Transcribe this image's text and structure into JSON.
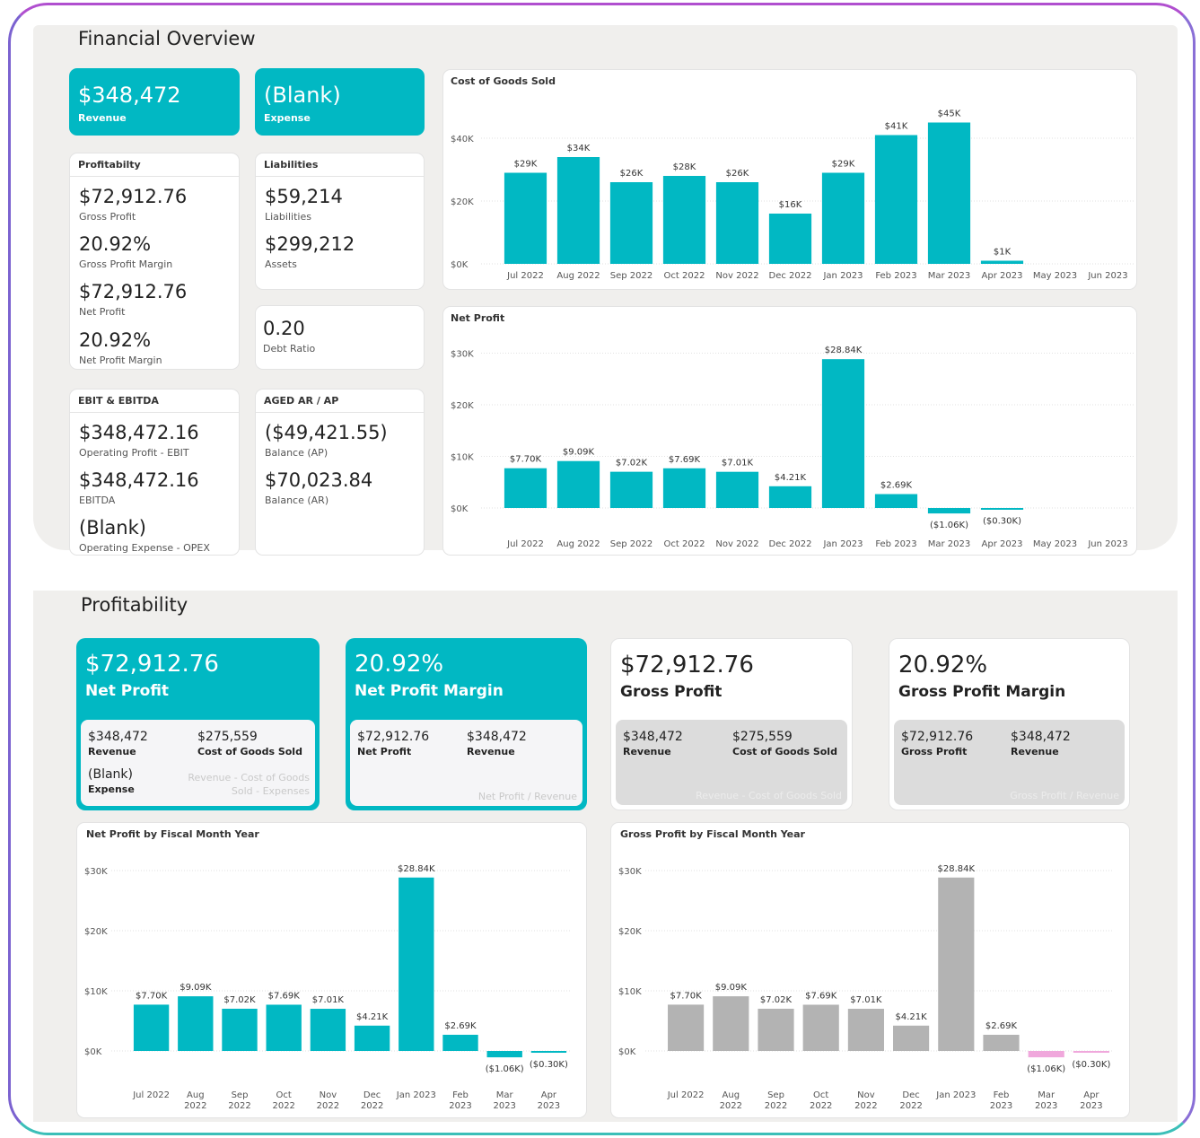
{
  "financial_overview": {
    "title": "Financial Overview",
    "revenue_value": "$348,472",
    "revenue_label": "Revenue",
    "expense_value": "(Blank)",
    "expense_label": "Expense",
    "profitability": {
      "header": "Profitabilty",
      "gross_profit": "$72,912.76",
      "gross_profit_label": "Gross Profit",
      "gross_margin": "20.92%",
      "gross_margin_label": "Gross Profit Margin",
      "net_profit": "$72,912.76",
      "net_profit_label": "Net Profit",
      "net_margin": "20.92%",
      "net_margin_label": "Net Profit Margin"
    },
    "liabilities": {
      "header": "Liabilities",
      "liabilities": "$59,214",
      "liabilities_label": "Liabilities",
      "assets": "$299,212",
      "assets_label": "Assets"
    },
    "debt_ratio": {
      "value": "0.20",
      "label": "Debt Ratio"
    },
    "ebit": {
      "header": "EBIT & EBITDA",
      "ebit": "$348,472.16",
      "ebit_label": "Operating Profit - EBIT",
      "ebitda": "$348,472.16",
      "ebitda_label": "EBITDA",
      "opex": "(Blank)",
      "opex_label": "Operating Expense - OPEX"
    },
    "aged": {
      "header": "AGED AR / AP",
      "ap": "($49,421.55)",
      "ap_label": "Balance (AP)",
      "ar": "$70,023.84",
      "ar_label": "Balance (AR)"
    }
  },
  "profitability_section": {
    "title": "Profitability",
    "net_profit_card": {
      "value": "$72,912.76",
      "label": "Net Profit",
      "revenue": "$348,472",
      "revenue_label": "Revenue",
      "cogs": "$275,559",
      "cogs_label": "Cost of Goods Sold",
      "expense": "(Blank)",
      "expense_label": "Expense",
      "formula": "Revenue - Cost of Goods Sold - Expenses"
    },
    "net_margin_card": {
      "value": "20.92%",
      "label": "Net Profit Margin",
      "net_profit": "$72,912.76",
      "net_profit_label": "Net Profit",
      "revenue": "$348,472",
      "revenue_label": "Revenue",
      "formula": "Net Profit / Revenue"
    },
    "gross_profit_card": {
      "value": "$72,912.76",
      "label": "Gross Profit",
      "revenue": "$348,472",
      "revenue_label": "Revenue",
      "cogs": "$275,559",
      "cogs_label": "Cost of Goods Sold",
      "formula": "Revenue - Cost of Goods Sold"
    },
    "gross_margin_card": {
      "value": "20.92%",
      "label": "Gross Profit Margin",
      "gross_profit": "$72,912.76",
      "gross_profit_label": "Gross Profit",
      "revenue": "$348,472",
      "revenue_label": "Revenue",
      "formula": "Gross Profit / Revenue"
    }
  },
  "colors": {
    "teal": "#01b8c3",
    "grey_bar": "#b3b3b3",
    "pink_bar": "#f0a8dc"
  },
  "chart_data": [
    {
      "type": "bar",
      "title": "Cost of Goods Sold",
      "categories": [
        "Jul 2022",
        "Aug 2022",
        "Sep 2022",
        "Oct 2022",
        "Nov 2022",
        "Dec 2022",
        "Jan 2023",
        "Feb 2023",
        "Mar 2023",
        "Apr 2023",
        "May 2023",
        "Jun 2023"
      ],
      "values": [
        29000,
        34000,
        26000,
        28000,
        26000,
        16000,
        29000,
        41000,
        45000,
        1000,
        null,
        null
      ],
      "labels": [
        "$29K",
        "$34K",
        "$26K",
        "$28K",
        "$26K",
        "$16K",
        "$29K",
        "$41K",
        "$45K",
        "$1K",
        "",
        ""
      ],
      "yticks": [
        "$0K",
        "$20K",
        "$40K"
      ],
      "ylim": [
        0,
        45000
      ]
    },
    {
      "type": "bar",
      "title": "Net Profit",
      "categories": [
        "Jul 2022",
        "Aug 2022",
        "Sep 2022",
        "Oct 2022",
        "Nov 2022",
        "Dec 2022",
        "Jan 2023",
        "Feb 2023",
        "Mar 2023",
        "Apr 2023",
        "May 2023",
        "Jun 2023"
      ],
      "values": [
        7700,
        9090,
        7020,
        7690,
        7010,
        4210,
        28840,
        2690,
        -1060,
        -300,
        null,
        null
      ],
      "labels": [
        "$7.70K",
        "$9.09K",
        "$7.02K",
        "$7.69K",
        "$7.01K",
        "$4.21K",
        "$28.84K",
        "$2.69K",
        "($1.06K)",
        "($0.30K)",
        "",
        ""
      ],
      "yticks": [
        "$0K",
        "$10K",
        "$20K",
        "$30K"
      ],
      "ylim": [
        -1060,
        28840
      ]
    },
    {
      "type": "bar",
      "title": "Net Profit by Fiscal Month Year",
      "categories": [
        "Jul 2022",
        "Aug 2022",
        "Sep 2022",
        "Oct 2022",
        "Nov 2022",
        "Dec 2022",
        "Jan 2023",
        "Feb 2023",
        "Mar 2023",
        "Apr 2023"
      ],
      "values": [
        7700,
        9090,
        7020,
        7690,
        7010,
        4210,
        28840,
        2690,
        -1060,
        -300
      ],
      "labels": [
        "$7.70K",
        "$9.09K",
        "$7.02K",
        "$7.69K",
        "$7.01K",
        "$4.21K",
        "$28.84K",
        "$2.69K",
        "($1.06K)",
        "($0.30K)"
      ],
      "yticks": [
        "$0K",
        "$10K",
        "$20K",
        "$30K"
      ],
      "ylim": [
        -1060,
        28840
      ]
    },
    {
      "type": "bar",
      "title": "Gross Profit by Fiscal Month Year",
      "categories": [
        "Jul 2022",
        "Aug 2022",
        "Sep 2022",
        "Oct 2022",
        "Nov 2022",
        "Dec 2022",
        "Jan 2023",
        "Feb 2023",
        "Mar 2023",
        "Apr 2023"
      ],
      "values": [
        7700,
        9090,
        7020,
        7690,
        7010,
        4210,
        28840,
        2690,
        -1060,
        -300
      ],
      "labels": [
        "$7.70K",
        "$9.09K",
        "$7.02K",
        "$7.69K",
        "$7.01K",
        "$4.21K",
        "$28.84K",
        "$2.69K",
        "($1.06K)",
        "($0.30K)"
      ],
      "yticks": [
        "$0K",
        "$10K",
        "$20K",
        "$30K"
      ],
      "ylim": [
        -1060,
        28840
      ]
    }
  ]
}
